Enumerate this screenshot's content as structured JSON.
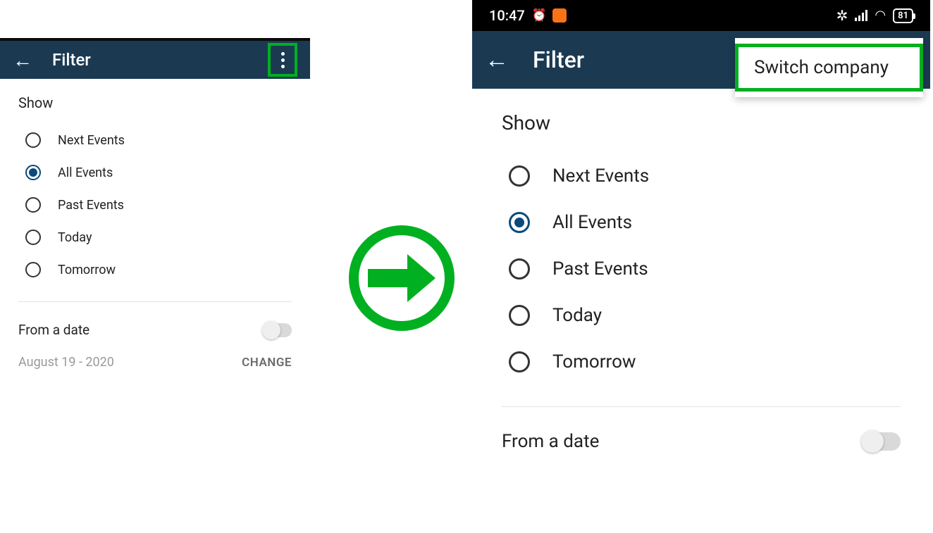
{
  "left": {
    "appbar": {
      "title": "Filter"
    },
    "show_label": "Show",
    "options": [
      {
        "label": "Next Events",
        "selected": false
      },
      {
        "label": "All Events",
        "selected": true
      },
      {
        "label": "Past Events",
        "selected": false
      },
      {
        "label": "Today",
        "selected": false
      },
      {
        "label": "Tomorrow",
        "selected": false
      }
    ],
    "from_label": "From a date",
    "date_text": "August 19 - 2020",
    "change_label": "CHANGE"
  },
  "right": {
    "status": {
      "time": "10:47",
      "battery": "81"
    },
    "appbar": {
      "title": "Filter"
    },
    "menu": {
      "switch_company": "Switch company"
    },
    "show_label": "Show",
    "options": [
      {
        "label": "Next Events",
        "selected": false
      },
      {
        "label": "All Events",
        "selected": true
      },
      {
        "label": "Past Events",
        "selected": false
      },
      {
        "label": "Today",
        "selected": false
      },
      {
        "label": "Tomorrow",
        "selected": false
      }
    ],
    "from_label": "From a date"
  }
}
